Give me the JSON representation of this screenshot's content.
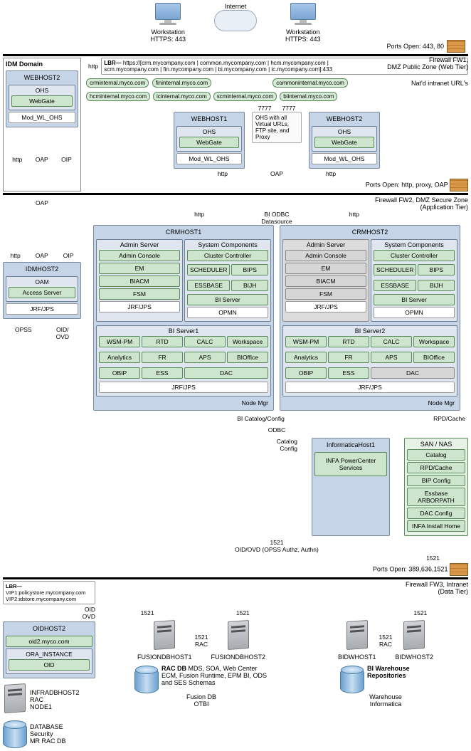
{
  "top": {
    "internet": "Internet",
    "workstation_left": "Workstation",
    "workstation_right": "Workstation",
    "https_left": "HTTPS: 443",
    "https_right": "HTTPS: 443",
    "ports_open_web": "Ports Open: 443, 80"
  },
  "fw1": {
    "label": "Firewall FW1,",
    "sub": "DMZ Public Zone (Web Tier)"
  },
  "idm": {
    "title": "IDM Domain",
    "http_in": "http",
    "webhost2": {
      "title": "WEBHOST2",
      "ohs": "OHS",
      "webgate": "WebGate",
      "mod": "Mod_WL_OHS"
    },
    "proto_http": "http",
    "proto_oap": "OAP",
    "proto_oip": "OIP",
    "idmhost2": {
      "title": "IDMHOST2",
      "oam": "OAM",
      "access": "Access Server",
      "jrf": "JRF/JPS"
    },
    "opss": "OPSS",
    "oid_ovd": "OID/\nOVD"
  },
  "lbr_top": {
    "title": "LBR—",
    "row1": "https://[crm.mycompany.com | common.mycompany.com | hcm.mycompany.com |",
    "row2": "scm.mycompany.com | fin.mycompany.com | bi.mycompany.com | ic.mycompany.com]:433"
  },
  "natd_label": "Nat'd intranet URL's",
  "urls1": {
    "crm": "crminternal.myco.com",
    "fin": "fininternal.myco.com",
    "common": "commoninternal.myco.com"
  },
  "urls2": {
    "hcm": "hcminternal.myco.com",
    "ic": "icinternal.myco.com",
    "scm": "scminternal.myco.com",
    "bi": "biinternal.myco.com"
  },
  "port_7777_a": "7777",
  "port_7777_b": "7777",
  "webhost1": {
    "title": "WEBHOST1",
    "ohs": "OHS",
    "webgate": "WebGate",
    "mod": "Mod_WL_OHS"
  },
  "ohs_note": "OHS with all  Virtual URLs, FTP site, and Proxy",
  "webhost2_center": {
    "title": "WEBHOST2",
    "ohs": "OHS",
    "webgate": "WebGate",
    "mod": "Mod_WL_OHS"
  },
  "proto_row": {
    "http_l": "http",
    "oap": "OAP",
    "http_r": "http"
  },
  "ports_open_app": "Ports Open: http, proxy, OAP",
  "fw2": {
    "label": "Firewall FW2, DMZ Secure Zone",
    "sub": "(Application Tier)"
  },
  "oap_left": "OAP",
  "bi_odbc": "BI ODBC\nDatasource",
  "http_left_mid": "http",
  "http_right_mid": "http",
  "crmhost1": {
    "title": "CRMHOST1",
    "admin_title": "Admin Server",
    "sys_title": "System Components",
    "admin_console": "Admin Console",
    "em": "EM",
    "biacm": "BIACM",
    "fsm": "FSM",
    "jrf": "JRF/JPS",
    "cluster": "Cluster Controller",
    "scheduler": "SCHEDULER",
    "bips": "BIPS",
    "essbase": "ESSBASE",
    "bijh": "BIJH",
    "biserver": "BI Server",
    "opmn": "OPMN",
    "bi_server_grp": "BI Server1",
    "wsmpm": "WSM-PM",
    "rtd": "RTD",
    "calc": "CALC",
    "workspace": "Workspace",
    "analytics": "Analytics",
    "fr": "FR",
    "aps": "APS",
    "bioffice": "BIOffice",
    "obip": "OBIP",
    "ess": "ESS",
    "dac": "DAC",
    "jrf2": "JRF/JPS",
    "nodemgr": "Node Mgr"
  },
  "crmhost2": {
    "title": "CRMHOST2",
    "admin_title": "Admin Server",
    "sys_title": "System Components",
    "admin_console": "Admin Console",
    "em": "EM",
    "biacm": "BIACM",
    "fsm": "FSM",
    "jrf": "JRF/JPS",
    "cluster": "Cluster Controller",
    "scheduler": "SCHEDULER",
    "bips": "BIPS",
    "essbase": "ESSBASE",
    "bijh": "BIJH",
    "biserver": "BI Server",
    "opmn": "OPMN",
    "bi_server_grp": "BI Server2",
    "wsmpm": "WSM-PM",
    "rtd": "RTD",
    "calc": "CALC",
    "workspace": "Workspace",
    "analytics": "Analytics",
    "fr": "FR",
    "aps": "APS",
    "bioffice": "BIOffice",
    "obip": "OBIP",
    "ess": "ESS",
    "dac": "DAC",
    "jrf2": "JRF/JPS",
    "nodemgr": "Node Mgr"
  },
  "mid_arrows": {
    "bi_catalog": "BI Catalog/Config",
    "odbc": "ODBC",
    "rpd_cache": "RPD/Cache",
    "catalog": "Catalog",
    "config": "Config",
    "port1521": "1521",
    "oid_ovd": "OID/OVD (OPSS Authz, Authn)",
    "port1521_b": "1521"
  },
  "informatica": {
    "title": "InformaticaHost1",
    "infa": "INFA PowerCenter Services"
  },
  "sannas": {
    "title": "SAN / NAS",
    "catalog": "Catalog",
    "rpd": "RPD/Cache",
    "bip": "BIP Config",
    "essbase": "Essbase ARBORPATH",
    "dac": "DAC Config",
    "infa": "INFA Install Home"
  },
  "lbr_bottom": {
    "title": "LBR—",
    "vip1": "VIP1:policystore.mycompany.com",
    "vip2": "VIP2:idstore.mycompany.com"
  },
  "oid_arrow": "OID",
  "ovd_arrow": "OVD",
  "ports_open_data": "Ports Open: 389,636,1521",
  "fw3": {
    "label": "Firewall FW3, Intranet",
    "sub": "(Data Tier)"
  },
  "oidhost2": {
    "title": "OIDHOST2",
    "oid2": "oid2.myco.com",
    "ora": "ORA_INSTANCE",
    "oid": "OID"
  },
  "infra": {
    "title": "INFRADBHOST2",
    "rac": "RAC",
    "node": "NODE1"
  },
  "dbsec": {
    "title": "DATABASE",
    "sec": "Security",
    "mr": "MR RAC DB"
  },
  "port1521_left": "1521",
  "fusion_cluster": {
    "host1": "FUSIONDBHOST1",
    "host2": "FUSIONDBHOST2",
    "port": "1521",
    "port_rac": "1521\nRAC",
    "rac_label": "RAC DB",
    "rac_desc": "MDS, SOA, Web Center ECM, Fusion Runtime, EPM BI, ODS and SES Schemas",
    "fusion_db": "Fusion DB",
    "otbi": "OTBI"
  },
  "bidw_cluster": {
    "host1": "BIDWHOST1",
    "host2": "BIDWHOST2",
    "port": "1521",
    "port_rac": "1521\nRAC",
    "title": "BI Warehouse Repositories",
    "warehouse": "Warehouse",
    "informatica": "Informatica"
  }
}
